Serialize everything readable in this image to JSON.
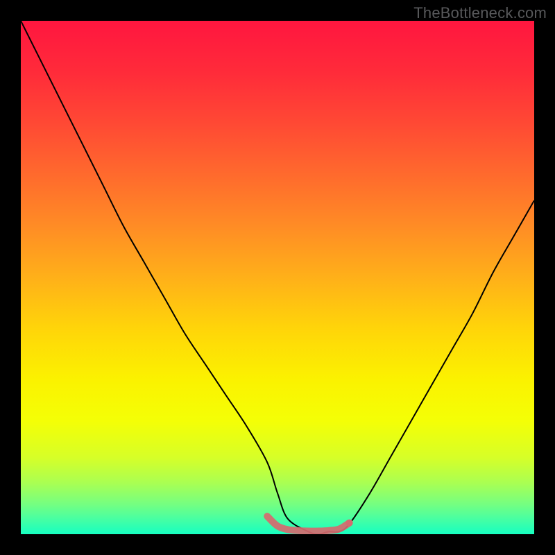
{
  "watermark": "TheBottleneck.com",
  "chart_data": {
    "type": "line",
    "title": "",
    "xlabel": "",
    "ylabel": "",
    "xlim": [
      0,
      100
    ],
    "ylim": [
      0,
      100
    ],
    "background_gradient": {
      "stops": [
        {
          "offset": 0.0,
          "color": "#ff163f"
        },
        {
          "offset": 0.1,
          "color": "#ff2b3a"
        },
        {
          "offset": 0.2,
          "color": "#ff4934"
        },
        {
          "offset": 0.3,
          "color": "#ff6a2d"
        },
        {
          "offset": 0.4,
          "color": "#ff8c25"
        },
        {
          "offset": 0.5,
          "color": "#ffb019"
        },
        {
          "offset": 0.6,
          "color": "#ffd509"
        },
        {
          "offset": 0.7,
          "color": "#fbf200"
        },
        {
          "offset": 0.78,
          "color": "#f4ff06"
        },
        {
          "offset": 0.85,
          "color": "#d7ff27"
        },
        {
          "offset": 0.9,
          "color": "#aaff52"
        },
        {
          "offset": 0.94,
          "color": "#77ff7f"
        },
        {
          "offset": 0.97,
          "color": "#48ffa2"
        },
        {
          "offset": 1.0,
          "color": "#16ffc1"
        }
      ]
    },
    "series": [
      {
        "name": "bottleneck-curve",
        "color": "#000000",
        "stroke_width": 2,
        "x": [
          0,
          4,
          8,
          12,
          16,
          20,
          24,
          28,
          32,
          36,
          40,
          44,
          48,
          50,
          52,
          56,
          58,
          60,
          62,
          64,
          68,
          72,
          76,
          80,
          84,
          88,
          92,
          96,
          100
        ],
        "y": [
          100,
          92,
          84,
          76,
          68,
          60,
          53,
          46,
          39,
          33,
          27,
          21,
          14,
          8,
          3,
          0.5,
          0,
          0.5,
          0.5,
          2,
          8,
          15,
          22,
          29,
          36,
          43,
          51,
          58,
          65
        ]
      }
    ],
    "highlight_band": {
      "name": "optimal-zone",
      "color": "#d66a6f",
      "stroke_width": 10,
      "opacity": 0.92,
      "x": [
        48,
        50,
        52,
        54,
        56,
        58,
        60,
        62,
        64
      ],
      "y": [
        3.5,
        1.6,
        0.9,
        0.7,
        0.6,
        0.6,
        0.7,
        1.0,
        2.2
      ]
    },
    "markers": [
      {
        "x": 64,
        "y": 2.2,
        "r": 5,
        "color": "#d66a6f"
      }
    ]
  }
}
